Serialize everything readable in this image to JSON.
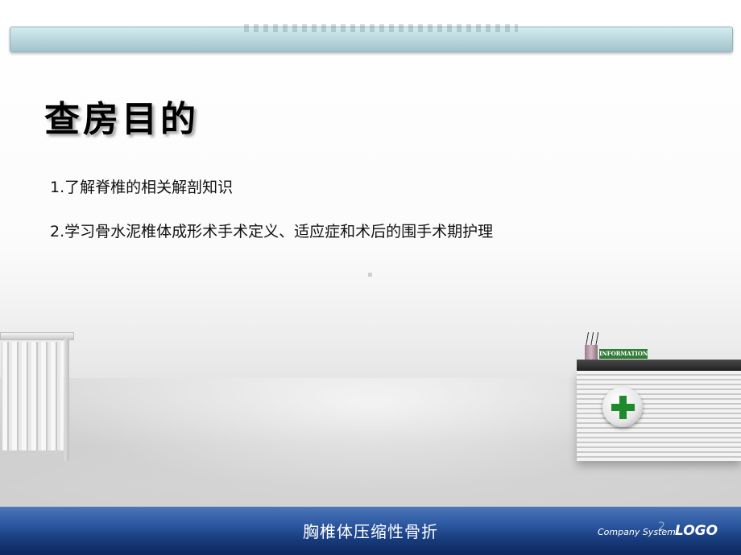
{
  "slide": {
    "title": "查房目的",
    "items": [
      "1.了解脊椎的相关解剖知识",
      "2.学习骨水泥椎体成形术手术定义、适应症和术后的围手术期护理"
    ]
  },
  "decor": {
    "info_sign": "INFORMATION",
    "cross_color": "#1f8a2c"
  },
  "footer": {
    "subject": "胸椎体压缩性骨折",
    "company": "Company System",
    "logo": "LOGO",
    "page_number": "2"
  },
  "colors": {
    "header_bar": "#b9d7dd",
    "footer_bar": "#173a7a"
  }
}
